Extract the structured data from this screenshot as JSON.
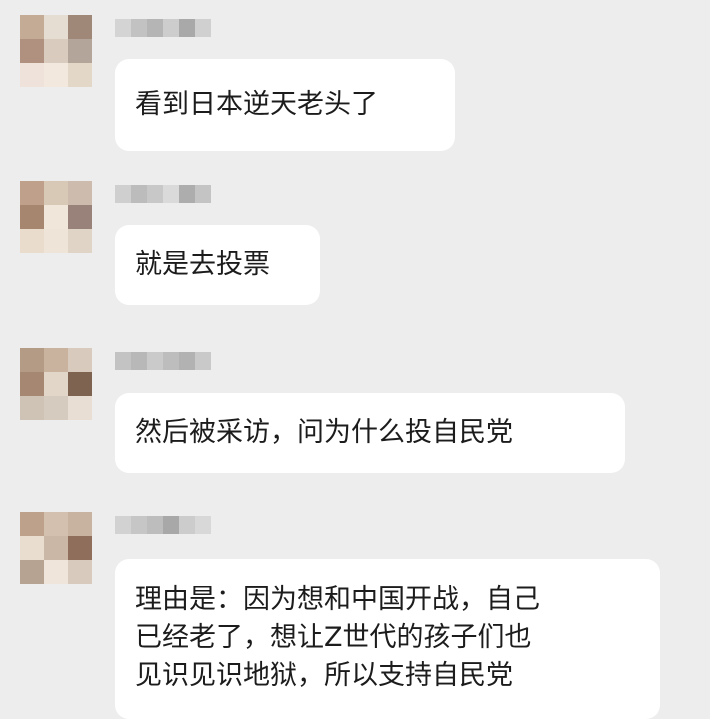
{
  "messages": [
    {
      "text_lines": [
        "看到日本逆天老头了"
      ],
      "avatar_colors": [
        "#c4ab96",
        "#e6ddd2",
        "#a08878",
        "#b0907e",
        "#d9cbbd",
        "#b3a59a",
        "#efe2da",
        "#f3e8dd",
        "#e3d7c8"
      ],
      "name_colors": [
        "#d4d4d4",
        "#c2c2c2",
        "#b5b5b5",
        "#cdcdcd",
        "#a9a9a9",
        "#d0d0d0"
      ]
    },
    {
      "text_lines": [
        "就是去投票"
      ],
      "avatar_colors": [
        "#bfa08a",
        "#d8c8b6",
        "#cdbcae",
        "#a78670",
        "#f1e6da",
        "#98827a",
        "#e9dccd",
        "#efe4d8",
        "#e0d4c6"
      ],
      "name_colors": [
        "#cfcfcf",
        "#bcbcbc",
        "#c8c8c8",
        "#dadada",
        "#adadad",
        "#c4c4c4"
      ]
    },
    {
      "text_lines": [
        "然后被采访，问为什么投自民党"
      ],
      "avatar_colors": [
        "#b49b86",
        "#c9b39f",
        "#d8cbbd",
        "#a58772",
        "#e2d6c9",
        "#7e6350",
        "#cfc3b6",
        "#d6cbbf",
        "#e8ded3"
      ],
      "name_colors": [
        "#c3c3c3",
        "#b8b8b8",
        "#cacaca",
        "#bdbdbd",
        "#b2b2b2",
        "#c9c9c9"
      ]
    },
    {
      "text_lines": [
        "理由是：因为想和中国开战，自己",
        "已经老了，想让Z世代的孩子们也",
        "见识见识地狱，所以支持自民党"
      ],
      "avatar_colors": [
        "#bea18b",
        "#d3c0ae",
        "#c8b3a0",
        "#e9ddd0",
        "#cbb7a5",
        "#8f6f5c",
        "#b7a392",
        "#efe5db",
        "#d8cbbd"
      ],
      "name_colors": [
        "#d2d2d2",
        "#c6c6c6",
        "#bdbdbd",
        "#a8a8a8",
        "#cccccc",
        "#d8d8d8"
      ]
    }
  ]
}
